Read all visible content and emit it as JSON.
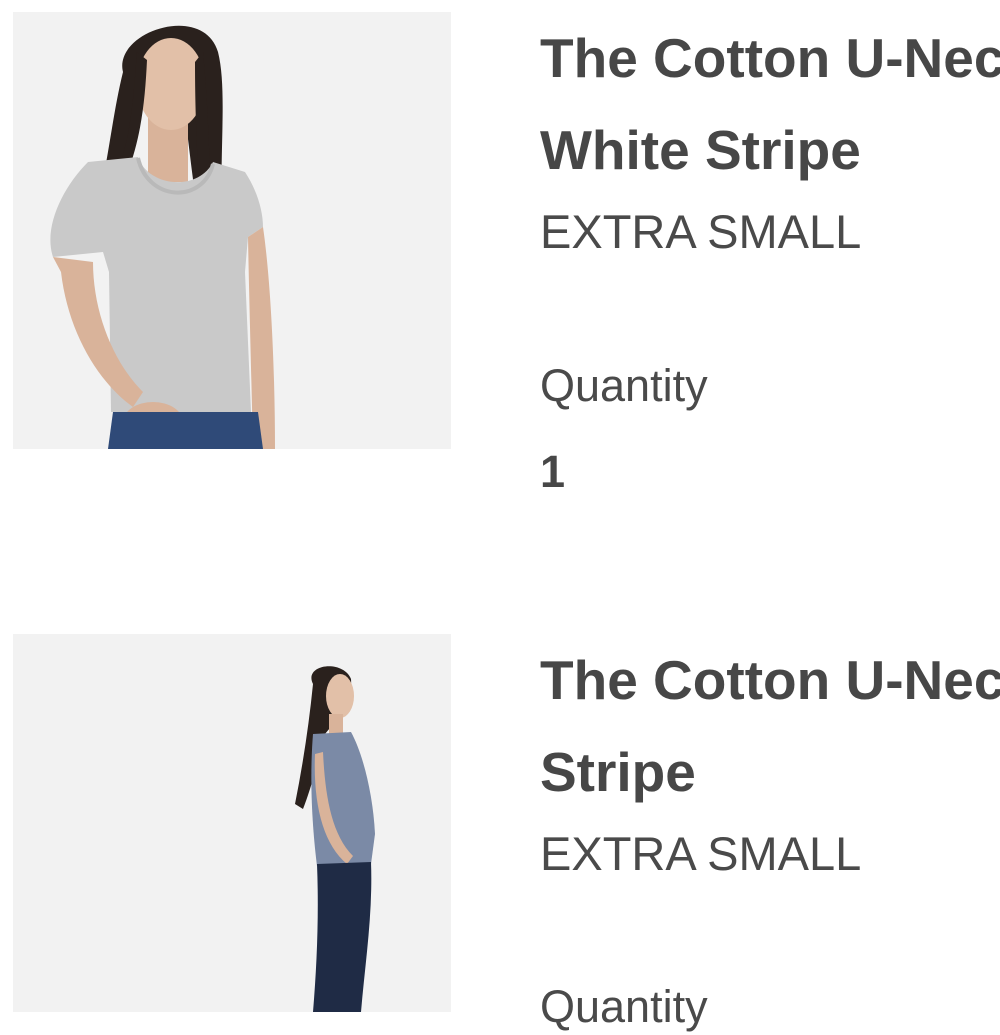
{
  "cart": {
    "items": [
      {
        "title_line1": "The Cotton U-Neck Tee",
        "title_line2": "White Stripe",
        "size": "EXTRA SMALL",
        "quantity_label": "Quantity",
        "quantity": "1",
        "image_alt": "product-photo-grey-scoop-tee"
      },
      {
        "title_line1": "The Cotton U-Neck Tee",
        "title_line2": "Stripe",
        "size": "EXTRA SMALL",
        "quantity_label": "Quantity",
        "image_alt": "product-photo-model-side-view"
      }
    ]
  },
  "colors": {
    "text": "#474747",
    "image_bg": "#f2f2f2"
  }
}
